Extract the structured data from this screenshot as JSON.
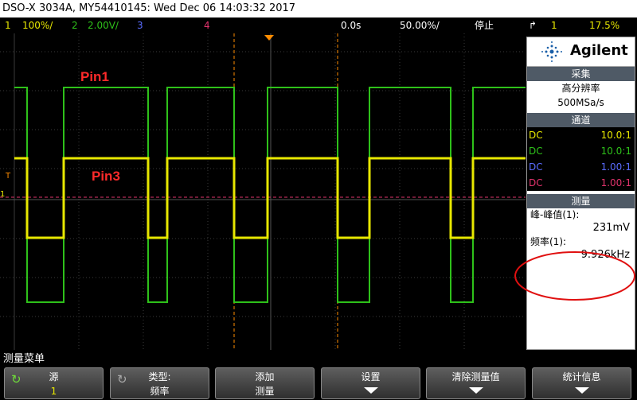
{
  "title_bar": "DSO-X 3034A, MY54410145: Wed Dec 06 14:03:32 2017",
  "status": {
    "ch1_num": "1",
    "ch1_scale": "100%/",
    "ch2_num": "2",
    "ch2_scale": "2.00V/",
    "ch3_num": "3",
    "ch4_num": "4",
    "time_delay": "0.0s",
    "time_scale": "50.00%/",
    "run_state": "停止",
    "trig_source": "1",
    "trig_level": "17.5%",
    "colors": {
      "ch1": "#e7e700",
      "ch2": "#2ec11a",
      "ch3": "#5a6cff",
      "ch4": "#e0336c",
      "trigger": "#ff8c00"
    }
  },
  "screen": {
    "pin1_label": "Pin1",
    "pin3_label": "Pin3",
    "trigger_marker": "T",
    "ground_marker": "1"
  },
  "panel": {
    "brand": "Agilent",
    "acq_header": "采集",
    "acq_mode": "高分辨率",
    "acq_rate": "500MSa/s",
    "chan_header": "通道",
    "channels": [
      {
        "coupling": "DC",
        "probe": "10.0:1",
        "color": "#e7e700"
      },
      {
        "coupling": "DC",
        "probe": "10.0:1",
        "color": "#2ec11a"
      },
      {
        "coupling": "DC",
        "probe": "1.00:1",
        "color": "#5a6cff"
      },
      {
        "coupling": "DC",
        "probe": "1.00:1",
        "color": "#e0336c"
      }
    ],
    "meas_header": "测量",
    "meas1_label": "峰-峰值(1):",
    "meas1_value": "231mV",
    "meas2_label": "频率(1):",
    "meas2_value": "9.926kHz"
  },
  "menu": {
    "title": "测量菜单",
    "softkeys": [
      {
        "line1": "源",
        "line2": "1"
      },
      {
        "line1": "类型:",
        "line2": "频率"
      },
      {
        "line1": "添加",
        "line2": "测量"
      },
      {
        "line1": "设置",
        "line2": ""
      },
      {
        "line1": "清除测量值",
        "line2": ""
      },
      {
        "line1": "统计信息",
        "line2": ""
      }
    ]
  }
}
